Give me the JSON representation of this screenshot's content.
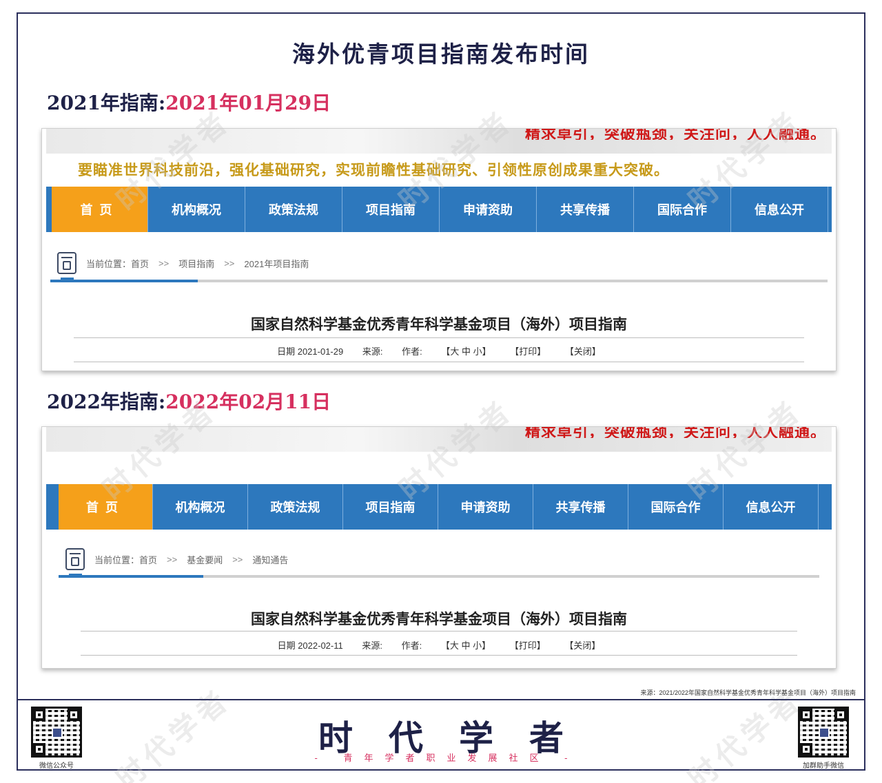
{
  "title": "海外优青项目指南发布时间",
  "sections": [
    {
      "heading_prefix": "2021年指南:",
      "heading_date": "2021年01月29日",
      "slogan": "精求卓引，突破瓶颈，关注问，人人融通。",
      "motto": "要瞄准世界科技前沿，强化基础研究，实现前瞻性基础研究、引领性原创成果重大突破。",
      "nav": [
        "首页",
        "机构概况",
        "政策法规",
        "项目指南",
        "申请资助",
        "共享传播",
        "国际合作",
        "信息公开"
      ],
      "breadcrumb": {
        "label": "当前位置：首页",
        "sep": ">>",
        "items": [
          "项目指南",
          "2021年项目指南"
        ]
      },
      "progress": 0.19,
      "article_title": "国家自然科学基金优秀青年科学基金项目（海外）项目指南",
      "meta": {
        "date": "日期 2021-01-29",
        "source": "来源:",
        "author": "作者:",
        "size": "【大 中 小】",
        "print": "【打印】",
        "close": "【关闭】"
      }
    },
    {
      "heading_prefix": "2022年指南:",
      "heading_date": "2022年02月11日",
      "slogan": "精求卓引，突破瓶颈，关注问，人人融通。",
      "nav": [
        "首页",
        "机构概况",
        "政策法规",
        "项目指南",
        "申请资助",
        "共享传播",
        "国际合作",
        "信息公开"
      ],
      "breadcrumb": {
        "label": "当前位置：首页",
        "sep": ">>",
        "items": [
          "基金要闻",
          "通知通告"
        ]
      },
      "progress": 0.19,
      "article_title": "国家自然科学基金优秀青年科学基金项目（海外）项目指南",
      "meta": {
        "date": "日期 2022-02-11",
        "source": "来源:",
        "author": "作者:",
        "size": "【大 中 小】",
        "print": "【打印】",
        "close": "【关闭】"
      }
    }
  ],
  "source_note": "来源：2021/2022年国家自然科学基金优秀青年科学基金项目（海外）项目指南",
  "brand": "时代学者",
  "brand_sub": "- 青年学者职业发展社区 -",
  "qr_left_label": "微信公众号",
  "qr_right_label": "加群助手微信",
  "watermark_text": "时代学者",
  "colors": {
    "navy": "#1e2147",
    "accent_pink": "#d6305f",
    "nav_blue": "#2d78bd",
    "nav_active": "#f5a01a",
    "motto_gold": "#c79a1a"
  }
}
